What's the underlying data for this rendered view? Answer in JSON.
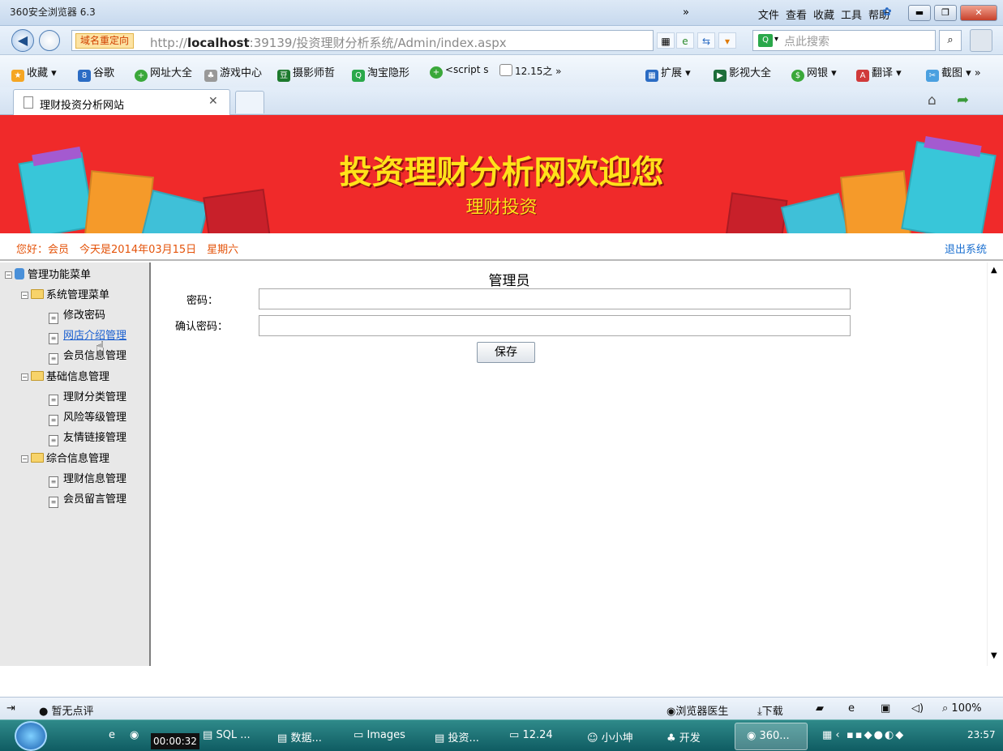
{
  "browser": {
    "title": "360安全浏览器 6.3",
    "menu": [
      "文件",
      "查看",
      "收藏",
      "工具",
      "帮助"
    ],
    "redirect_label": "域名重定向",
    "url_prefix": "http://",
    "url_host": "localhost",
    "url_rest": ":39139/投资理财分析系统/Admin/index.aspx",
    "search_placeholder": "点此搜索",
    "favorites": [
      "收藏",
      "谷歌",
      "网址大全",
      "游戏中心",
      "摄影师哲",
      "淘宝隐形",
      "<script s",
      "12.15之"
    ],
    "fav_right": [
      "扩展",
      "影视大全",
      "网银",
      "翻译",
      "截图"
    ],
    "tab_title": "理财投资分析网站"
  },
  "banner": {
    "title": "投资理财分析网欢迎您",
    "subtitle": "理财投资"
  },
  "info": {
    "greeting": "您好：会员　今天是2014年03月15日　星期六",
    "logout": "退出系统"
  },
  "sidebar": {
    "root": "管理功能菜单",
    "groups": [
      {
        "label": "系统管理菜单",
        "items": [
          "修改密码",
          "网店介绍管理",
          "会员信息管理"
        ]
      },
      {
        "label": "基础信息管理",
        "items": [
          "理财分类管理",
          "风险等级管理",
          "友情链接管理"
        ]
      },
      {
        "label": "综合信息管理",
        "items": [
          "理财信息管理",
          "会员留言管理"
        ]
      }
    ]
  },
  "form": {
    "title": "管理员",
    "password_label": "密码：",
    "confirm_label": "确认密码：",
    "password_value": "",
    "confirm_value": "",
    "save": "保存"
  },
  "status": {
    "left": "暂无点评",
    "doctor": "浏览器医生",
    "download": "下载",
    "zoom": "100%"
  },
  "taskbar": {
    "timer": "00:00:32",
    "items": [
      "SQL ...",
      "数据...",
      "Images",
      "投资...",
      "12.24",
      "小小坤",
      "开发",
      "360..."
    ],
    "clock": "23:57"
  },
  "colors": {
    "banner": "#f02a2a",
    "banner_text": "#ffe21a",
    "greeting": "#e4530a",
    "link": "#1a6fd0"
  }
}
